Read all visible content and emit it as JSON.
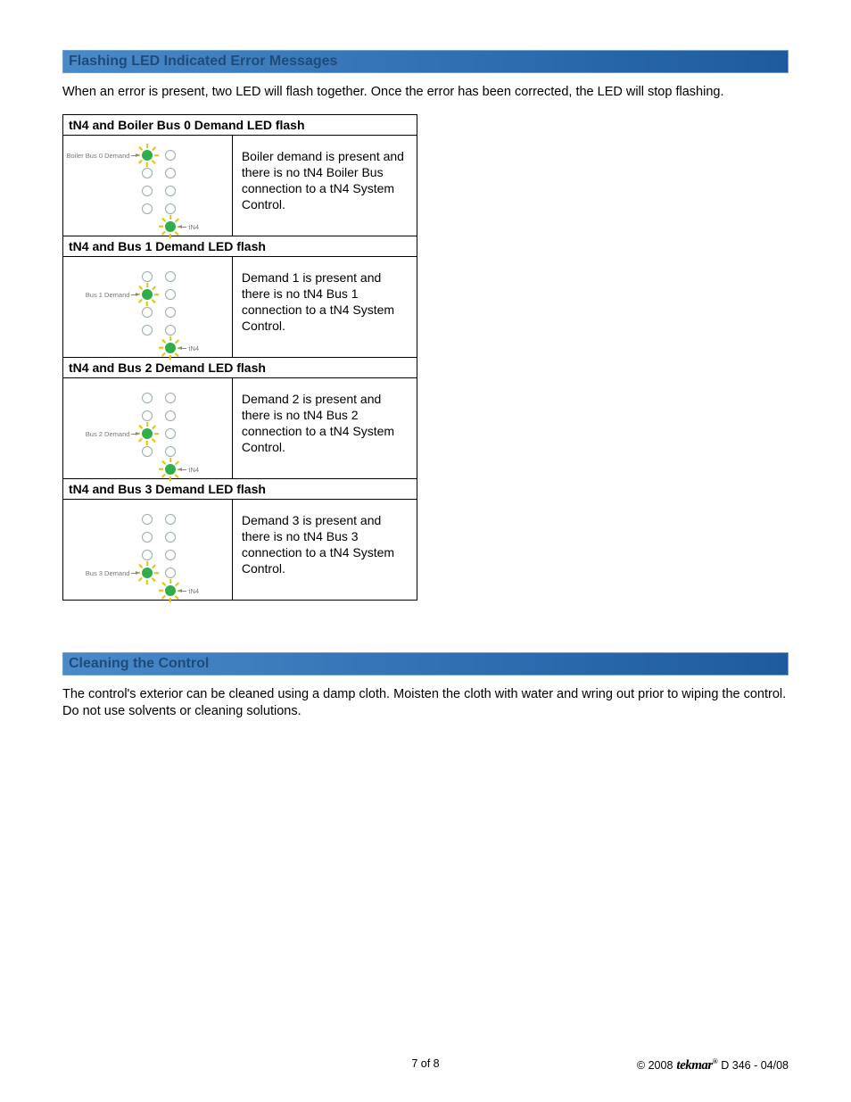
{
  "sections": {
    "flashing": {
      "title": "Flashing LED Indicated Error Messages",
      "intro": "When an error is present, two LED will flash together. Once the error has been corrected, the LED will stop flashing."
    },
    "cleaning": {
      "title": "Cleaning the Control",
      "body": "The control's exterior can be cleaned using a damp cloth. Moisten the cloth with water and wring out prior to wiping the control. Do not use solvents or cleaning solutions."
    }
  },
  "table": {
    "rows": [
      {
        "header": "tN4 and Boiler Bus 0 Demand LED flash",
        "left_label": "Boiler Bus 0 Demand",
        "tn4_label": "tN4",
        "left_row": 0,
        "description": "Boiler demand is present and there is no tN4 Boiler Bus connection to a tN4 System Control."
      },
      {
        "header": "tN4 and Bus 1 Demand LED flash",
        "left_label": "Bus 1 Demand",
        "tn4_label": "tN4",
        "left_row": 1,
        "description": "Demand 1 is present and there is no tN4 Bus 1 connection to a tN4 System Control."
      },
      {
        "header": "tN4 and Bus 2 Demand LED flash",
        "left_label": "Bus 2 Demand",
        "tn4_label": "tN4",
        "left_row": 2,
        "description": "Demand 2 is present and there is no tN4 Bus 2 connection to a tN4 System Control."
      },
      {
        "header": "tN4 and Bus 3 Demand LED flash",
        "left_label": "Bus 3 Demand",
        "tn4_label": "tN4",
        "left_row": 3,
        "description": "Demand 3 is present and there is no tN4 Bus 3 connection to a tN4 System Control."
      }
    ]
  },
  "footer": {
    "page": "7 of 8",
    "copyright": "© 2008",
    "brand": "tekmar",
    "doc": "D 346 - 04/08"
  }
}
